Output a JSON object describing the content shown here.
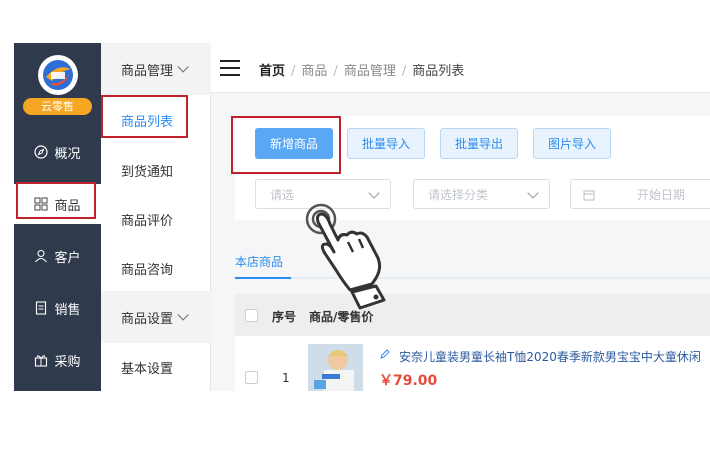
{
  "nav": {
    "brand": "云零售",
    "items": [
      {
        "label": "概况",
        "icon": "compass-icon"
      },
      {
        "label": "商品",
        "icon": "grid-icon"
      },
      {
        "label": "客户",
        "icon": "user-icon"
      },
      {
        "label": "销售",
        "icon": "document-icon"
      },
      {
        "label": "采购",
        "icon": "gift-icon"
      }
    ]
  },
  "submenu": {
    "group1": "商品管理",
    "items1": [
      "商品列表",
      "到货通知",
      "商品评价",
      "商品咨询"
    ],
    "group2": "商品设置",
    "items2": [
      "基本设置"
    ]
  },
  "breadcrumb": {
    "home": "首页",
    "sep": "/",
    "c1": "商品",
    "c2": "商品管理",
    "c3": "商品列表"
  },
  "toolbar": {
    "add": "新增商品",
    "import": "批量导入",
    "export": "批量导出",
    "image_import": "图片导入"
  },
  "filters": {
    "brand_placeholder": "请选",
    "category_placeholder": "请选择分类",
    "date_placeholder": "开始日期"
  },
  "tab": "本店商品",
  "table": {
    "headers": {
      "index": "序号",
      "product": "商品/零售价"
    },
    "rows": [
      {
        "index": "1",
        "name": "安奈儿童装男童长袖T恤2020春季新款男宝宝中大童休闲",
        "price": "￥79.00"
      }
    ]
  },
  "colors": {
    "nav_bg": "#2f3a4d",
    "accent": "#2d8cf0",
    "highlight": "#c0212a",
    "price": "#e64a3a"
  }
}
